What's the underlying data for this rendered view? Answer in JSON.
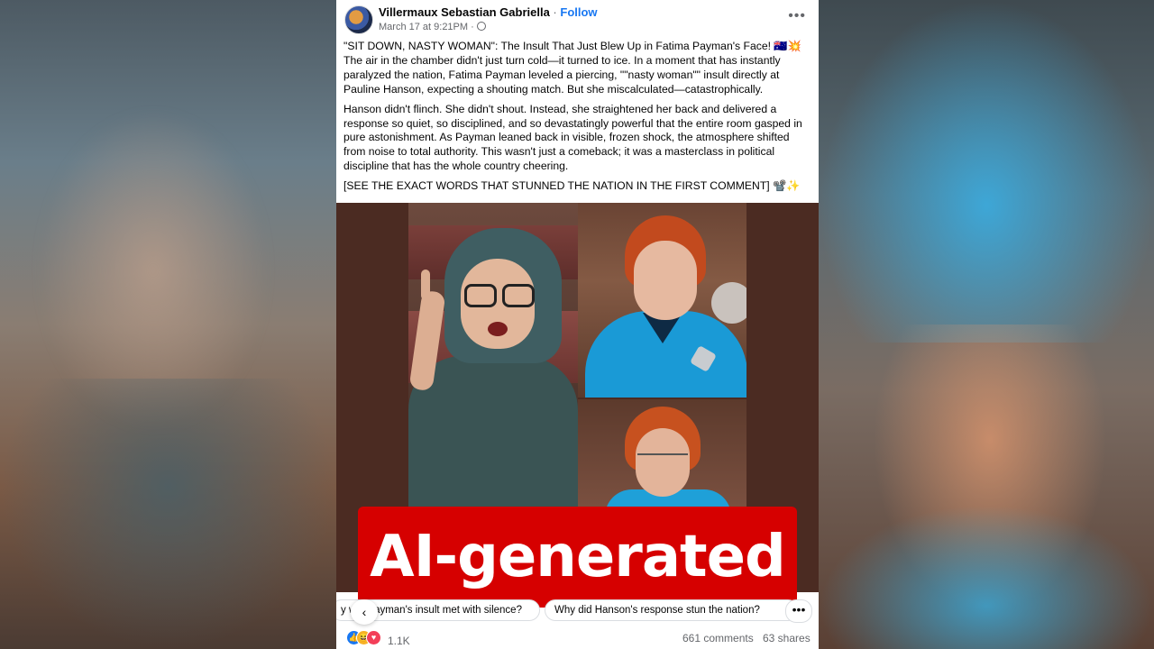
{
  "post": {
    "author": "Villermaux Sebastian Gabriella",
    "separator": "·",
    "follow_label": "Follow",
    "timestamp": "March 17 at 9:21PM ·",
    "more_label": "•••",
    "paragraphs": [
      "\"SIT DOWN, NASTY WOMAN\": The Insult That Just Blew Up in Fatima Payman's Face! 🇦🇺💥 The air in the chamber didn't just turn cold—it turned to ice. In a moment that has instantly paralyzed the nation, Fatima Payman leveled a piercing, \"\"nasty woman\"\" insult directly at Pauline Hanson, expecting a shouting match. But she miscalculated—catastrophically.",
      "Hanson didn't flinch. She didn't shout. Instead, she straightened her back and delivered a response so quiet, so disciplined, and so devastatingly powerful that the entire room gasped in pure astonishment. As Payman leaned back in visible, frozen shock, the atmosphere shifted from noise to total authority. This wasn't just a comeback; it was a masterclass in political discipline that has the whole country cheering.",
      "[SEE THE EXACT WORDS THAT STUNNED THE NATION IN THE FIRST COMMENT] 📽️✨"
    ]
  },
  "overlay": {
    "label": "AI-generated",
    "color": "#d60000"
  },
  "suggestions": {
    "chip_1": "y w... Payman's insult met with silence?",
    "chip_2": "Why did Hanson's response stun the nation?",
    "back_icon": "‹",
    "more_label": "•••"
  },
  "footer": {
    "reaction_icons": [
      "like",
      "haha",
      "love"
    ],
    "reaction_count": "1.1K",
    "comments": "661 comments",
    "shares": "63 shares"
  }
}
